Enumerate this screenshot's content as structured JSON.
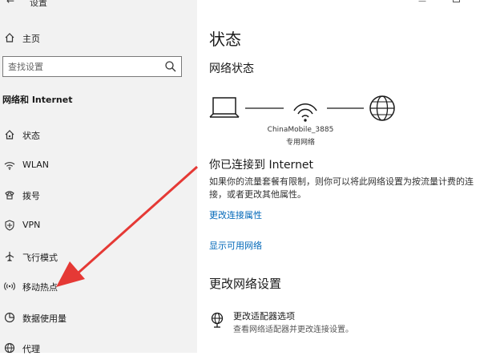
{
  "window": {
    "title": "设置"
  },
  "sidebar": {
    "home_label": "主页",
    "search_placeholder": "查找设置",
    "section_heading": "网络和 Internet",
    "items": [
      {
        "label": "状态",
        "icon": "home-status-icon"
      },
      {
        "label": "WLAN",
        "icon": "wifi-icon"
      },
      {
        "label": "拨号",
        "icon": "dialup-icon"
      },
      {
        "label": "VPN",
        "icon": "vpn-icon"
      },
      {
        "label": "飞行模式",
        "icon": "airplane-icon"
      },
      {
        "label": "移动热点",
        "icon": "hotspot-icon"
      },
      {
        "label": "数据使用量",
        "icon": "data-usage-icon"
      },
      {
        "label": "代理",
        "icon": "globe-icon"
      }
    ]
  },
  "main": {
    "title": "状态",
    "network_status_heading": "网络状态",
    "network_name": "ChinaMobile_3885",
    "network_type": "专用网络",
    "connected_title": "你已连接到 Internet",
    "connected_desc": "如果你的流量套餐有限制，则你可以将此网络设置为按流量计费的连接，或者更改其他属性。",
    "link_change_props": "更改连接属性",
    "link_show_networks": "显示可用网络",
    "change_settings_heading": "更改网络设置",
    "adapter_option_title": "更改适配器选项",
    "adapter_option_desc": "查看网络适配器并更改连接设置。"
  },
  "colors": {
    "sidebar_bg": "#f2f2f2",
    "link": "#0067b8",
    "annotation_arrow": "#e53935"
  }
}
